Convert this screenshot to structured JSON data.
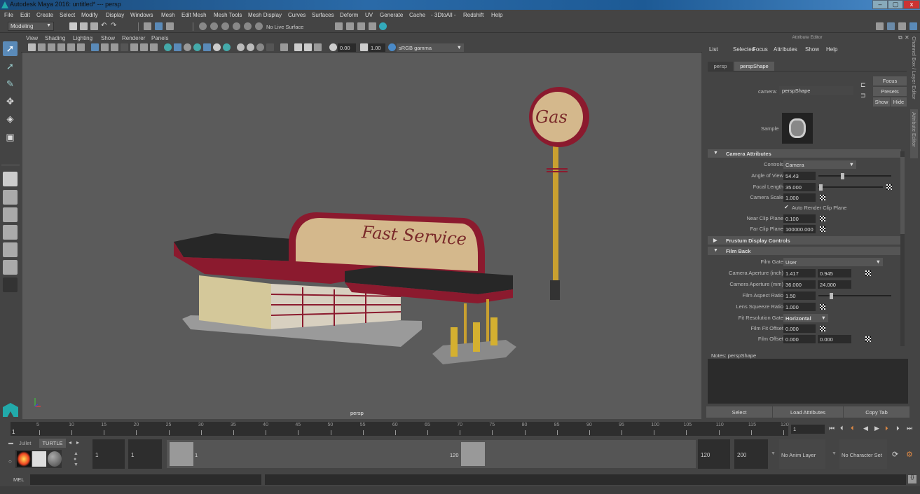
{
  "window": {
    "title": "Autodesk Maya 2016: untitled*   ---   persp",
    "minimize": "–",
    "maximize": "▢",
    "close": "x"
  },
  "menubar": [
    "File",
    "Edit",
    "Create",
    "Select",
    "Modify",
    "Display",
    "Windows",
    "Mesh",
    "Edit Mesh",
    "Mesh Tools",
    "Mesh Display",
    "Curves",
    "Surfaces",
    "Deform",
    "UV",
    "Generate",
    "Cache",
    "- 3DtoAll -",
    "Redshift",
    "Help"
  ],
  "statusline": {
    "mode": "Modeling",
    "live_surface": "No Live Surface"
  },
  "viewport": {
    "menu": [
      "View",
      "Shading",
      "Lighting",
      "Show",
      "Renderer",
      "Panels"
    ],
    "exposure": "0.00",
    "gamma": "1.00",
    "color_space": "sRGB gamma",
    "camera_label": "persp",
    "scene": {
      "sign_text": "Fast Service",
      "pole_sign_text": "Gas"
    }
  },
  "attribute_editor": {
    "title": "Attribute Editor",
    "menu": [
      "List",
      "Selected",
      "Focus",
      "Attributes",
      "Show",
      "Help"
    ],
    "tabs": [
      "persp",
      "perspShape"
    ],
    "active_tab": "perspShape",
    "camera_label": "camera:",
    "camera_value": "perspShape",
    "buttons": {
      "focus": "Focus",
      "presets": "Presets",
      "show": "Show",
      "hide": "Hide"
    },
    "sample_label": "Sample",
    "sections": {
      "camera": "Camera Attributes",
      "frustum": "Frustum Display Controls",
      "film_back": "Film Back"
    },
    "camera_attrs": {
      "controls_label": "Controls",
      "controls_value": "Camera",
      "angle_of_view_label": "Angle of View",
      "angle_of_view": "54.43",
      "focal_length_label": "Focal Length",
      "focal_length": "35.000",
      "camera_scale_label": "Camera Scale",
      "camera_scale": "1.000",
      "auto_render_clip": "Auto Render Clip Plane",
      "near_clip_label": "Near Clip Plane",
      "near_clip": "0.100",
      "far_clip_label": "Far Clip Plane",
      "far_clip": "100000.000"
    },
    "film_back": {
      "film_gate_label": "Film Gate",
      "film_gate": "User",
      "aperture_inch_label": "Camera Aperture (inch)",
      "aperture_inch_x": "1.417",
      "aperture_inch_y": "0.945",
      "aperture_mm_label": "Camera Aperture (mm)",
      "aperture_mm_x": "36.000",
      "aperture_mm_y": "24.000",
      "aspect_label": "Film Aspect Ratio",
      "aspect": "1.50",
      "squeeze_label": "Lens Squeeze Ratio",
      "squeeze": "1.000",
      "fit_gate_label": "Fit Resolution Gate",
      "fit_gate": "Horizontal",
      "fit_offset_label": "Film Fit Offset",
      "fit_offset": "0.000",
      "offset_label": "Film Offset",
      "offset_x": "0.000",
      "offset_y": "0.000"
    },
    "notes_label": "Notes:  perspShape",
    "bottom_buttons": [
      "Select",
      "Load Attributes",
      "Copy Tab"
    ],
    "side_tabs": [
      "Channel Box / Layer Editor",
      "Attribute Editor"
    ]
  },
  "timeline": {
    "ticks": [
      "5",
      "10",
      "15",
      "20",
      "25",
      "30",
      "35",
      "40",
      "45",
      "50",
      "55",
      "60",
      "65",
      "70",
      "75",
      "80",
      "85",
      "90",
      "95",
      "100",
      "105",
      "110",
      "115",
      "120"
    ],
    "start_marker": "1",
    "current_frame": "1"
  },
  "range": {
    "shelf_tabs": [
      "Jullet",
      "TURTLE"
    ],
    "start": "1",
    "playback_start": "1",
    "slider_start": "1",
    "slider_end": "120",
    "playback_end": "120",
    "end": "200",
    "anim_layer": "No Anim Layer",
    "character_set": "No Character Set"
  },
  "command": {
    "label": "MEL"
  }
}
